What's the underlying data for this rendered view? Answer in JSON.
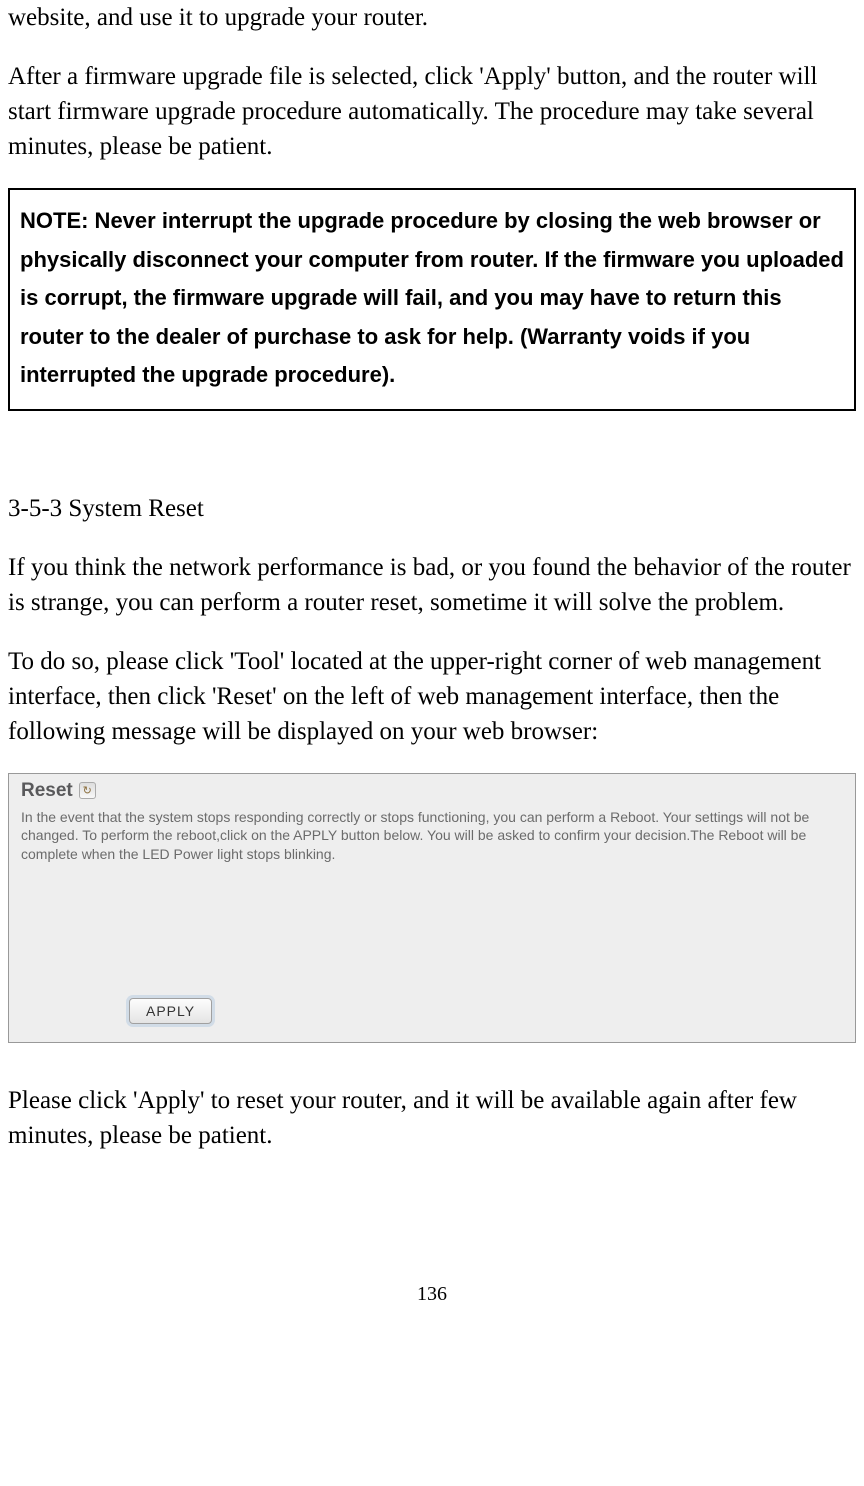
{
  "paragraphs": {
    "p1": "website, and use it to upgrade your router.",
    "p2": "After a firmware upgrade file is selected, click 'Apply' button, and the router will start firmware upgrade procedure automatically. The procedure may take several minutes, please be patient.",
    "p3": "If you think the network performance is bad, or you found the behavior of the router is strange, you can perform a router reset, sometime it will solve the problem.",
    "p4": "To do so, please click 'Tool' located at the upper-right corner of web management interface, then click 'Reset' on the left of web management interface, then the following message will be displayed on your web browser:",
    "p5": "Please click 'Apply' to reset your router, and it will be available again after few minutes, please be patient."
  },
  "note": {
    "text": "NOTE: Never interrupt the upgrade procedure by closing the web browser or physically disconnect your computer from router. If the firmware you uploaded is corrupt, the firmware upgrade will fail, and you may have to return this router to the dealer of purchase to ask for help. (Warranty voids if you interrupted the upgrade procedure)."
  },
  "section": {
    "heading": "3-5-3 System Reset"
  },
  "screenshot": {
    "title": "Reset",
    "icon_glyph": "↻",
    "description": "In the event that the system stops responding correctly or stops functioning, you can perform a Reboot. Your settings will not be changed. To perform the reboot,click on the APPLY button below. You will be asked to confirm your decision.The Reboot will be complete when the LED Power light stops blinking.",
    "apply_label": "APPLY"
  },
  "page_number": "136"
}
